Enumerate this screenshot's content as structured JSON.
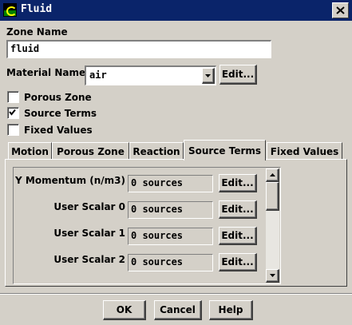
{
  "window": {
    "title": "Fluid",
    "colors": {
      "titlebar": "#0a246a",
      "face": "#d4d0c8"
    }
  },
  "zone": {
    "label": "Zone Name",
    "value": "fluid"
  },
  "material": {
    "label": "Material Name",
    "selected": "air",
    "edit_label": "Edit..."
  },
  "options": [
    {
      "label": "Porous Zone",
      "checked": false
    },
    {
      "label": "Source Terms",
      "checked": true
    },
    {
      "label": "Fixed Values",
      "checked": false
    }
  ],
  "tabs": [
    {
      "label": "Motion",
      "active": false
    },
    {
      "label": "Porous Zone",
      "active": false
    },
    {
      "label": "Reaction",
      "active": false
    },
    {
      "label": "Source Terms",
      "active": true
    },
    {
      "label": "Fixed Values",
      "active": false
    }
  ],
  "source_rows": [
    {
      "label": "Y Momentum (n/m3)",
      "value": "0 sources",
      "edit_label": "Edit..."
    },
    {
      "label": "User Scalar 0",
      "value": "0 sources",
      "edit_label": "Edit..."
    },
    {
      "label": "User Scalar 1",
      "value": "0 sources",
      "edit_label": "Edit..."
    },
    {
      "label": "User Scalar 2",
      "value": "0 sources",
      "edit_label": "Edit..."
    }
  ],
  "footer": {
    "ok": "OK",
    "cancel": "Cancel",
    "help": "Help"
  },
  "icons": {
    "close": "close-icon",
    "dropdown": "chevron-down-icon",
    "scroll_up": "arrow-up-icon",
    "scroll_down": "arrow-down-icon"
  }
}
